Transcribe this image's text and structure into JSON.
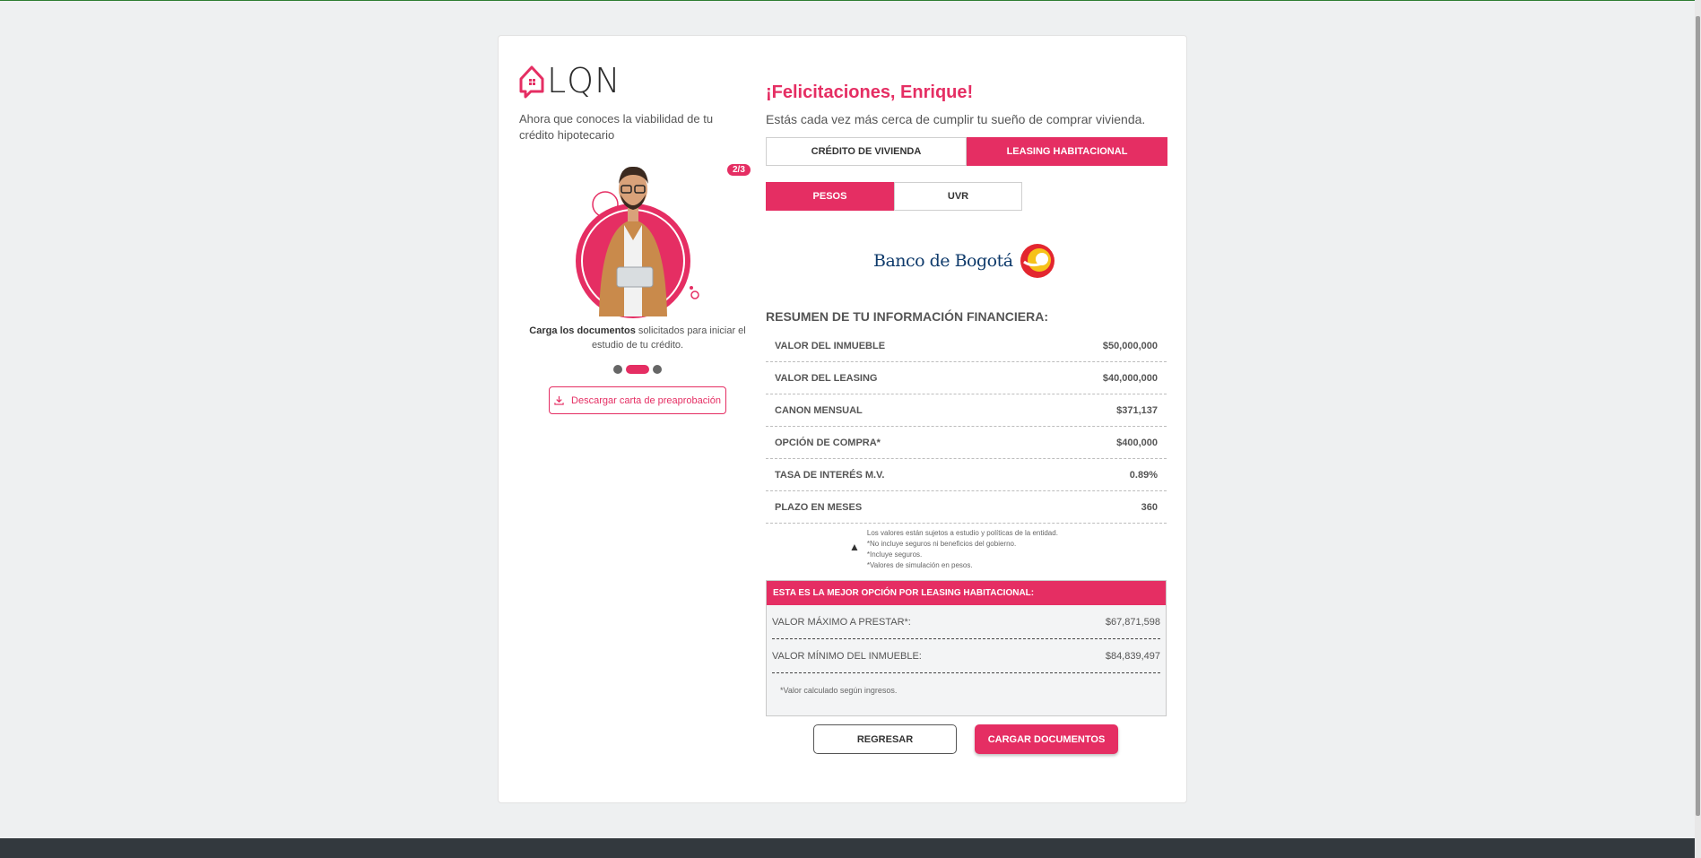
{
  "brand": {
    "name": "LQN",
    "accent": "#e52e63"
  },
  "left": {
    "intro": "Ahora que conoces la viabilidad de tu crédito hipotecario",
    "step_badge": "2/3",
    "doc_bold": "Carga los documentos",
    "doc_rest": " solicitados para iniciar el estudio de tu crédito.",
    "download_label": "Descargar carta de preaprobación"
  },
  "main": {
    "title": "¡Felicitaciones, Enrique!",
    "subtitle": "Estás cada vez más cerca de cumplir tu sueño de comprar vivienda.",
    "product_tabs": [
      {
        "label": "CRÉDITO DE VIVIENDA",
        "active": false
      },
      {
        "label": "LEASING HABITACIONAL",
        "active": true
      }
    ],
    "currency_tabs": [
      {
        "label": "PESOS",
        "active": true
      },
      {
        "label": "UVR",
        "active": false
      }
    ],
    "bank": "Banco de Bogotá",
    "summary_title": "RESUMEN DE TU INFORMACIÓN FINANCIERA:",
    "summary": [
      {
        "label": "VALOR DEL INMUEBLE",
        "value": "$50,000,000"
      },
      {
        "label": "VALOR DEL LEASING",
        "value": "$40,000,000"
      },
      {
        "label": "CANON MENSUAL",
        "value": "$371,137"
      },
      {
        "label": "OPCIÓN DE COMPRA*",
        "value": "$400,000"
      },
      {
        "label": "TASA DE INTERÉS M.V.",
        "value": "0.89%"
      },
      {
        "label": "PLAZO EN MESES",
        "value": "360"
      }
    ],
    "notes": [
      "Los valores están sujetos a estudio y políticas de la entidad.",
      "*No incluye seguros ni beneficios del gobierno.",
      "*Incluye seguros.",
      "*Valores de simulación en pesos."
    ],
    "best": {
      "title": "ESTA ES LA MEJOR OPCIÓN POR LEASING HABITACIONAL:",
      "rows": [
        {
          "label": "VALOR MÁXIMO A PRESTAR*:",
          "value": "$67,871,598"
        },
        {
          "label": "VALOR MÍNIMO DEL INMUEBLE:",
          "value": "$84,839,497"
        }
      ],
      "footnote": "*Valor calculado según ingresos."
    },
    "back_label": "REGRESAR",
    "upload_label": "CARGAR DOCUMENTOS"
  }
}
